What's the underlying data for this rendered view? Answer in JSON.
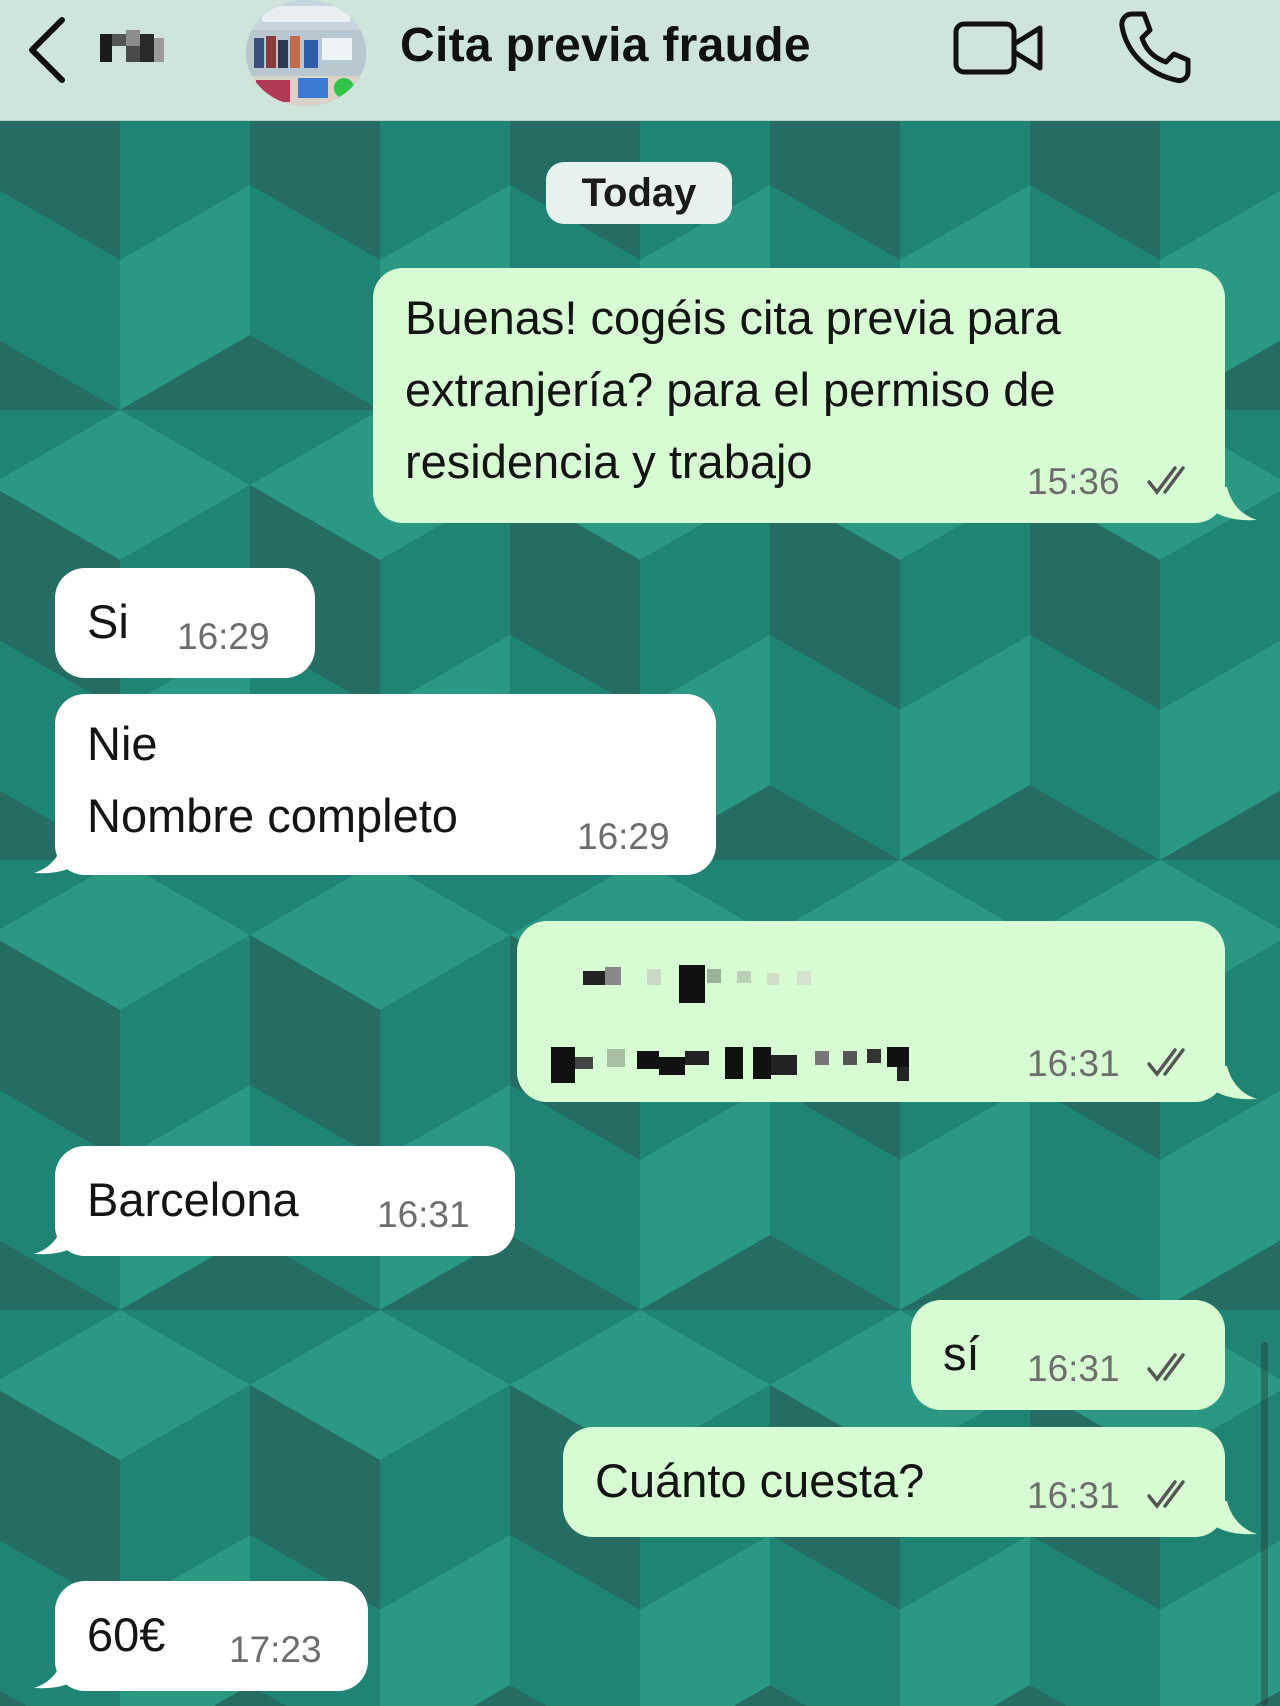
{
  "header": {
    "title": "Cita previa fraude",
    "back_icon": "chevron-left-icon",
    "video_icon": "video-camera-icon",
    "call_icon": "phone-icon"
  },
  "date_separator": "Today",
  "messages": [
    {
      "direction": "outgoing",
      "lines": [
        "Buenas! cogéis cita previa para",
        "extranjería? para el permiso de",
        "residencia y trabajo"
      ],
      "time": "15:36",
      "status": "read"
    },
    {
      "direction": "incoming",
      "lines": [
        "Si"
      ],
      "time": "16:29"
    },
    {
      "direction": "incoming",
      "lines": [
        "Nie",
        "Nombre completo"
      ],
      "time": "16:29"
    },
    {
      "direction": "outgoing",
      "redacted": true,
      "time": "16:31",
      "status": "read"
    },
    {
      "direction": "incoming",
      "lines": [
        "Barcelona"
      ],
      "time": "16:31"
    },
    {
      "direction": "outgoing",
      "lines": [
        "sí"
      ],
      "time": "16:31",
      "status": "read"
    },
    {
      "direction": "outgoing",
      "lines": [
        "Cuánto cuesta?"
      ],
      "time": "16:31",
      "status": "read"
    },
    {
      "direction": "incoming",
      "lines": [
        "60€"
      ],
      "time": "17:23"
    }
  ],
  "colors": {
    "wallpaper_light": "#2a9883",
    "wallpaper_mid": "#1f8474",
    "wallpaper_dark": "#266b62",
    "outgoing_bubble": "#d7fbd2",
    "incoming_bubble": "#ffffff",
    "header_bg": "#cfe5dc"
  }
}
